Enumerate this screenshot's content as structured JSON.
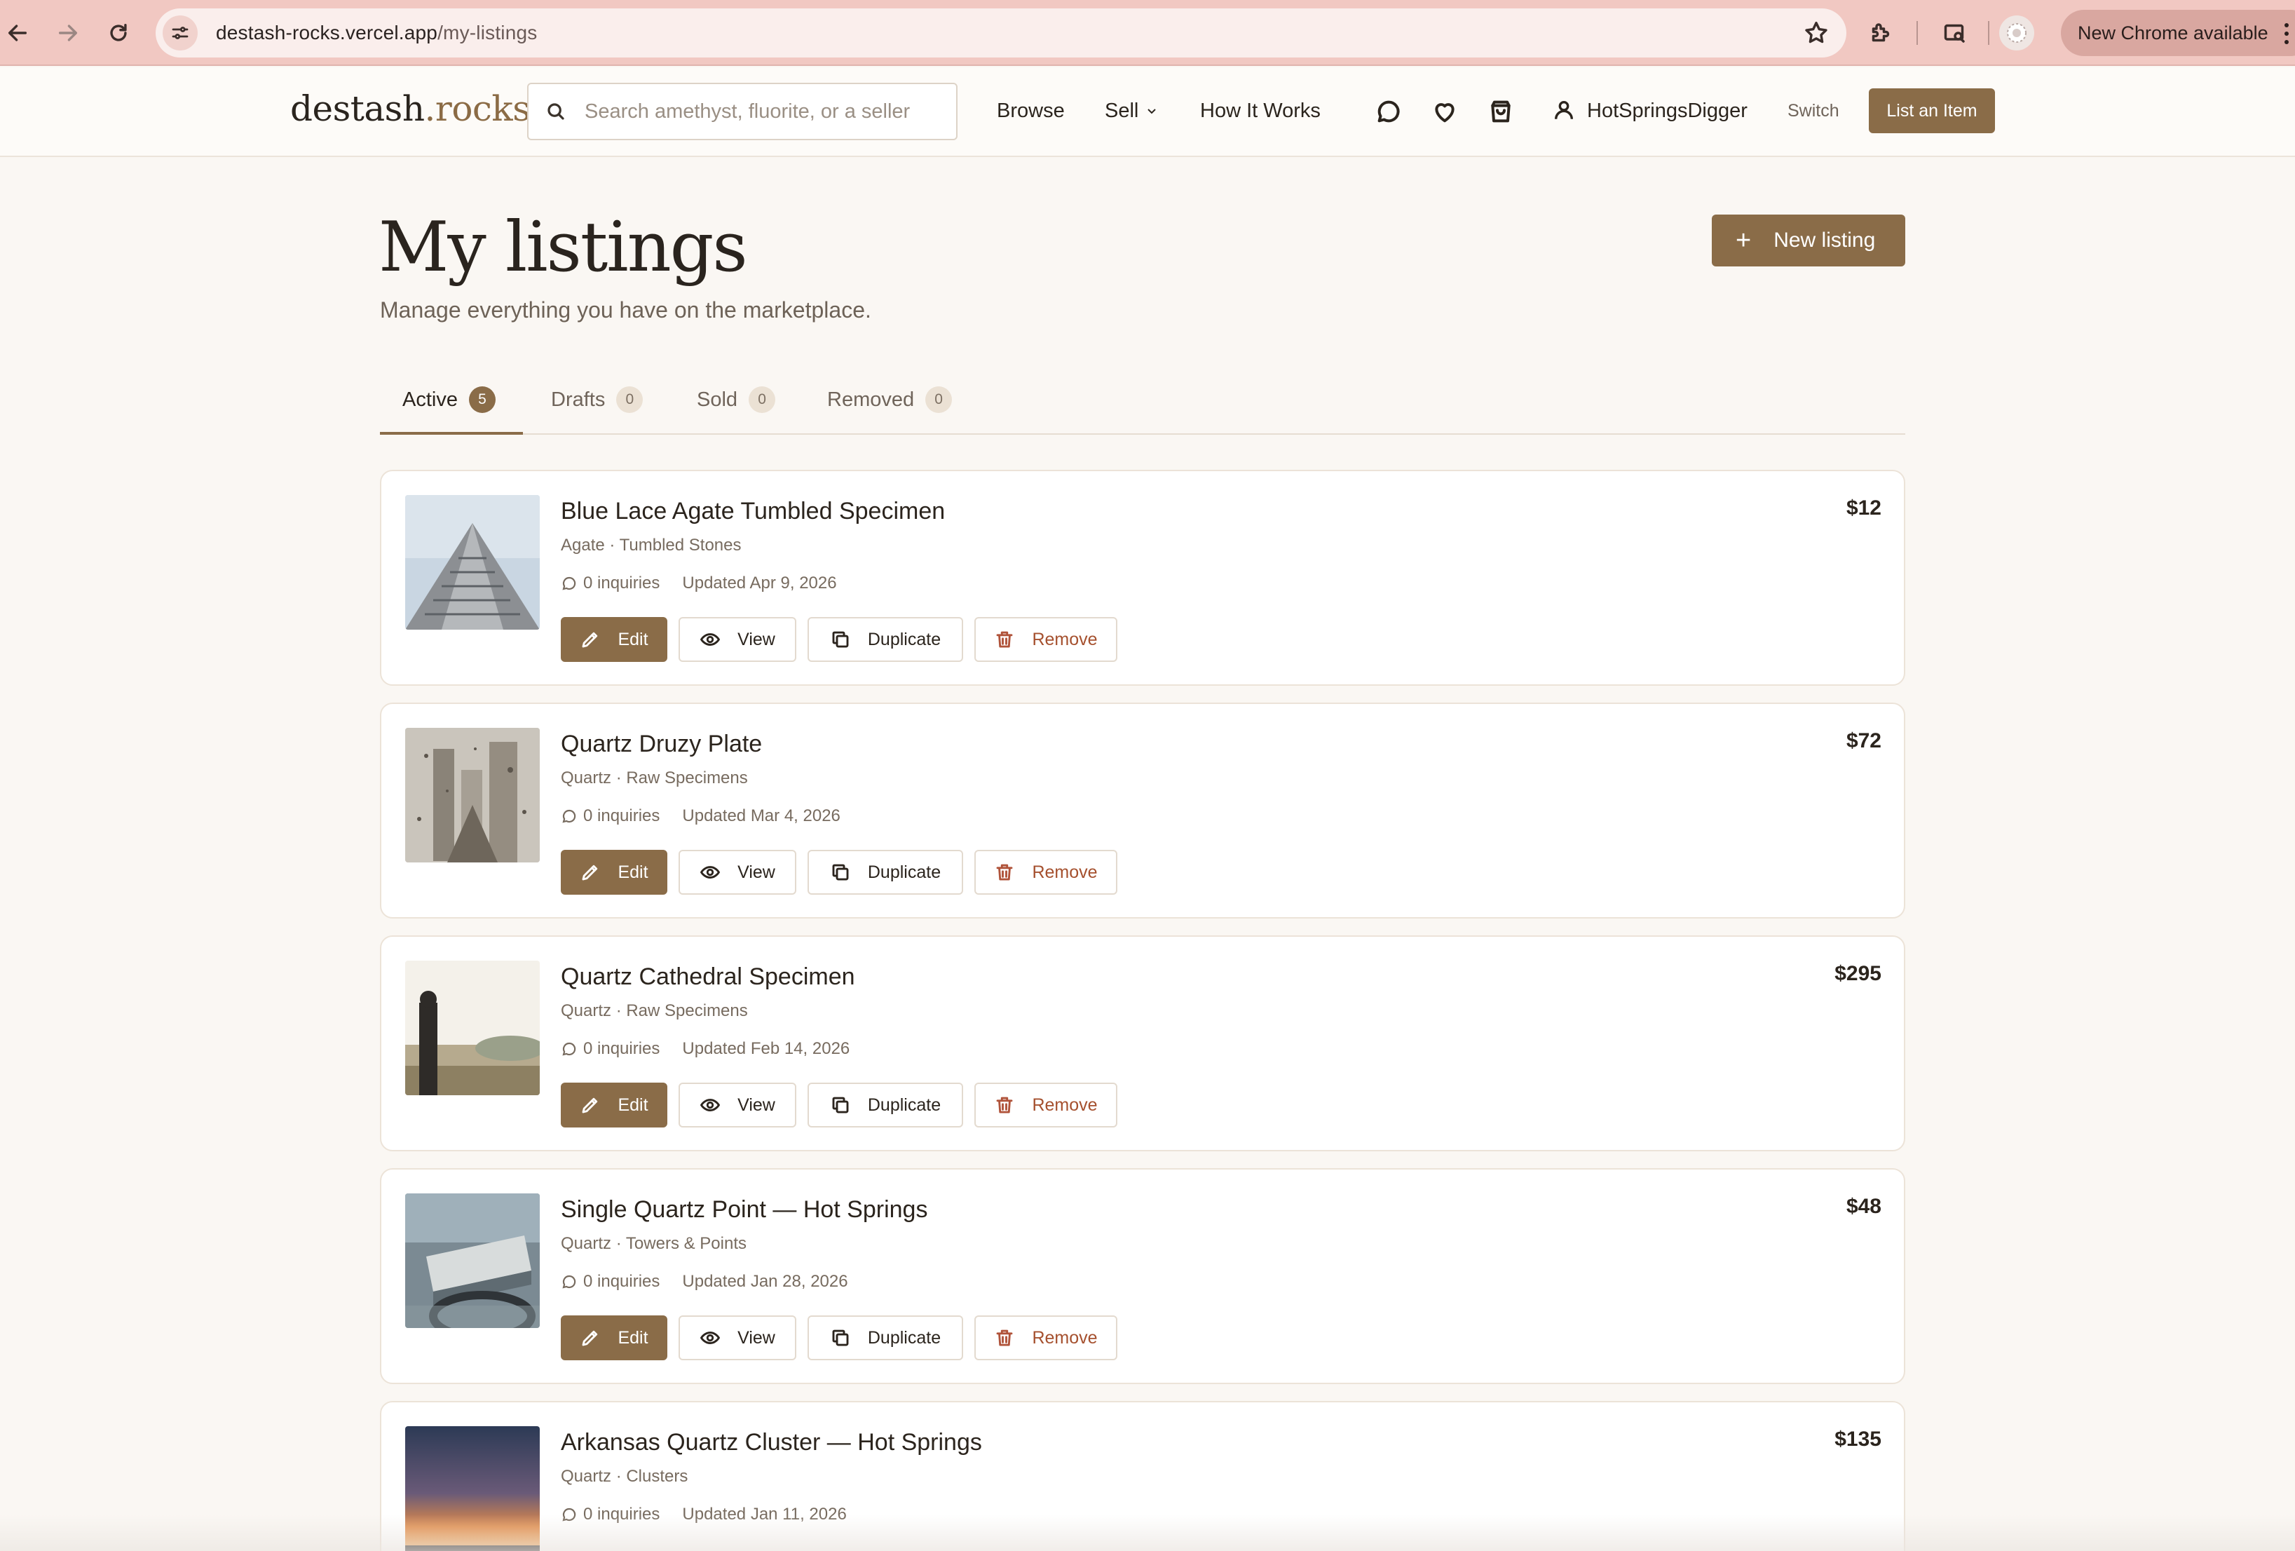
{
  "browser": {
    "url_host": "destash-rocks.vercel.app",
    "url_path": "/my-listings",
    "update_label": "New Chrome available"
  },
  "header": {
    "logo_main": "destash",
    "logo_accent": ".rocks",
    "search_placeholder": "Search amethyst, fluorite, or a seller",
    "nav": {
      "browse": "Browse",
      "sell": "Sell",
      "how_it_works": "How It Works"
    },
    "username": "HotSpringsDigger",
    "switch_label": "Switch",
    "list_item_label": "List an Item"
  },
  "page": {
    "title": "My listings",
    "subtitle": "Manage everything you have on the marketplace.",
    "new_listing_label": "New listing"
  },
  "tabs": [
    {
      "label": "Active",
      "count": "5"
    },
    {
      "label": "Drafts",
      "count": "0"
    },
    {
      "label": "Sold",
      "count": "0"
    },
    {
      "label": "Removed",
      "count": "0"
    }
  ],
  "actions": {
    "edit": "Edit",
    "view": "View",
    "duplicate": "Duplicate",
    "remove": "Remove"
  },
  "listings": [
    {
      "title": "Blue Lace Agate Tumbled Specimen",
      "category": "Agate · Tumbled Stones",
      "inquiries": "0 inquiries",
      "updated": "Updated Apr 9, 2026",
      "price": "$12"
    },
    {
      "title": "Quartz Druzy Plate",
      "category": "Quartz · Raw Specimens",
      "inquiries": "0 inquiries",
      "updated": "Updated Mar 4, 2026",
      "price": "$72"
    },
    {
      "title": "Quartz Cathedral Specimen",
      "category": "Quartz · Raw Specimens",
      "inquiries": "0 inquiries",
      "updated": "Updated Feb 14, 2026",
      "price": "$295"
    },
    {
      "title": "Single Quartz Point — Hot Springs",
      "category": "Quartz · Towers & Points",
      "inquiries": "0 inquiries",
      "updated": "Updated Jan 28, 2026",
      "price": "$48"
    },
    {
      "title": "Arkansas Quartz Cluster — Hot Springs",
      "category": "Quartz · Clusters",
      "inquiries": "0 inquiries",
      "updated": "Updated Jan 11, 2026",
      "price": "$135"
    }
  ]
}
